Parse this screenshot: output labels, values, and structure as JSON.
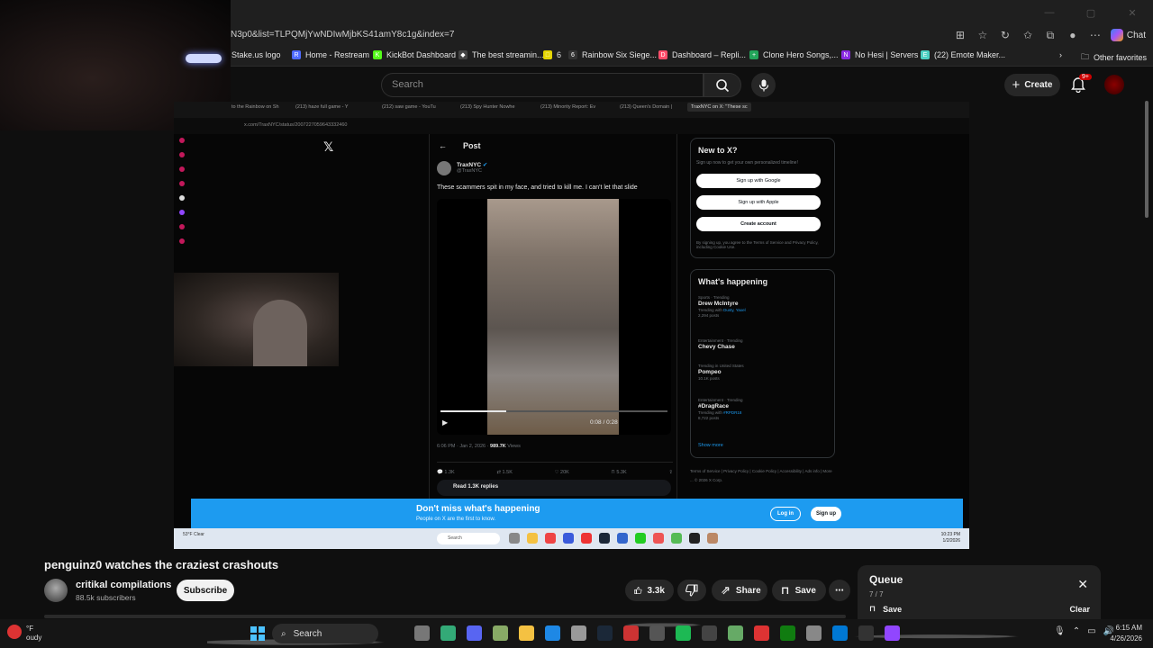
{
  "browser": {
    "url": "N3p0&list=TLPQMjYwNDIwMjbKS41amY8c1g&index=7",
    "chat_label": "Chat",
    "bookmarks": [
      {
        "label": "Stake.us logo",
        "color": "#1a2c38",
        "icon": "S"
      },
      {
        "label": "Home - Restream",
        "color": "#4f6bff",
        "icon": "R"
      },
      {
        "label": "KickBot Dashboard",
        "color": "#53fc18",
        "icon": "K"
      },
      {
        "label": "The best streamin...",
        "color": "#444444",
        "icon": "◆"
      },
      {
        "label": "6",
        "color": "#e4d500",
        "icon": "□"
      },
      {
        "label": "Rainbow Six Siege...",
        "color": "#333333",
        "icon": "6"
      },
      {
        "label": "Dashboard – Repli...",
        "color": "#ff4d6a",
        "icon": "D"
      },
      {
        "label": "Clone Hero Songs,...",
        "color": "#23a55a",
        "icon": "+"
      },
      {
        "label": "No Hesi | Servers",
        "color": "#8a2be2",
        "icon": "N"
      },
      {
        "label": "(22) Emote Maker...",
        "color": "#4dd0c4",
        "icon": "E"
      }
    ],
    "other_favorites": "Other favorites"
  },
  "youtube": {
    "search_placeholder": "Search",
    "create_label": "Create",
    "notif_badge": "9+",
    "video_title": "penguinz0 watches the craziest crashouts",
    "channel_name": "critikal compilations",
    "channel_subs": "88.5k subscribers",
    "subscribe_label": "Subscribe",
    "like_count": "3.3k",
    "share_label": "Share",
    "save_label": "Save",
    "queue": {
      "title": "Queue",
      "count": "7 / 7",
      "save_label": "Save",
      "clear_label": "Clear"
    }
  },
  "video_frame": {
    "tabs": [
      "to the Rainbow on Sh",
      "(213) haze full game - Y",
      "(212) saw game - YouTu",
      "(213) Spy Hunter Nowhe",
      "(213) Minority Report: Ev",
      "(213) Queen's Domain | ",
      "TraxNYC on X: \"These sc"
    ],
    "inner_url": "x.com/TraxNYC/status/2007227059643332460",
    "post_header": "Post",
    "author_name": "TraxNYC",
    "author_handle": "@TraxNYC",
    "tweet_text": "These scammers spit in my face, and tried to kill me. I can't let that slide",
    "video_time": "0:08 / 0:28",
    "video_progress": 0.29,
    "post_time": "6:06 PM · Jan 2, 2026 · ",
    "views": "989.7K",
    "views_label": " Views",
    "counts": [
      "1.3K",
      "1.5K",
      "20K",
      "5.3K"
    ],
    "read_replies": "Read 1.3K replies",
    "newx_title": "New to X?",
    "newx_sub": "Sign up now to get your own personalized timeline!",
    "google_btn": "Sign up with Google",
    "apple_btn": "Sign up with Apple",
    "create_btn": "Create account",
    "legal": "By signing up, you agree to the Terms of Service and Privacy Policy, including Cookie Use.",
    "happening_title": "What's happening",
    "trends": [
      {
        "cat": "Sports · Trending",
        "name": "Drew McIntyre",
        "sub": "Trending with ",
        "sub_em": "Dusty, Yaxel",
        "posts": "2,294 posts"
      },
      {
        "cat": "Entertainment · Trending",
        "name": "Chevy Chase",
        "sub": "",
        "sub_em": "",
        "posts": ""
      },
      {
        "cat": "Trending in United States",
        "name": "Pompeo",
        "sub": "",
        "sub_em": "",
        "posts": "10.1K posts"
      },
      {
        "cat": "Entertainment · Trending",
        "name": "#DragRace",
        "sub": "Trending with ",
        "sub_em": "#RPDR18",
        "posts": "8,722 posts"
      }
    ],
    "show_more": "Show more",
    "footer_links": "Terms of Service | Privacy Policy | Cookie Policy | Accessibility | Ads info | More ... © 2026 X Corp.",
    "banner_title": "Don't miss what's happening",
    "banner_sub": "People on X are the first to know.",
    "login_label": "Log in",
    "signup_label": "Sign up",
    "inner_weather": "53°F Clear",
    "inner_search": "Search",
    "inner_time": "10:23 PM",
    "inner_date": "1/2/2026"
  },
  "taskbar": {
    "weather_temp": "°F",
    "weather_cond": "oudy",
    "search_label": "Search",
    "time": "6:15 AM",
    "date": "4/26/2026"
  }
}
